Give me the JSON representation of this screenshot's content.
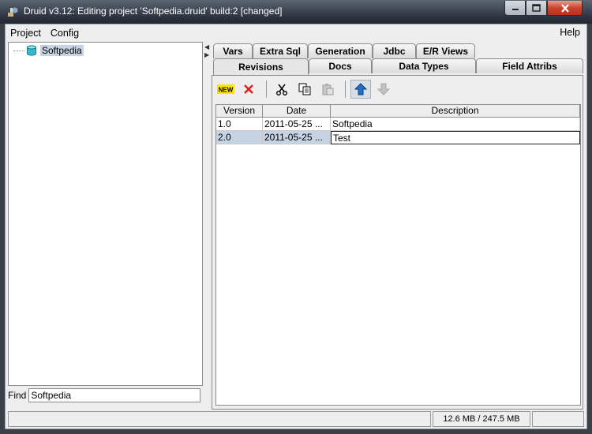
{
  "window": {
    "title": "Druid v3.12: Editing project 'Softpedia.druid' build:2 [changed]"
  },
  "menu": {
    "project": "Project",
    "config": "Config",
    "help": "Help"
  },
  "tree": {
    "root_label": "Softpedia"
  },
  "find": {
    "label": "Find",
    "value": "Softpedia"
  },
  "tabs": {
    "row1": [
      "Vars",
      "Extra Sql",
      "Generation",
      "Jdbc",
      "E/R Views"
    ],
    "row2": [
      "Revisions",
      "Docs",
      "Data Types",
      "Field Attribs"
    ],
    "active": "Revisions"
  },
  "toolbar": {
    "new_label": "NEW"
  },
  "table": {
    "columns": [
      "Version",
      "Date",
      "Description"
    ],
    "rows": [
      {
        "version": "1.0",
        "date": "2011-05-25 ...",
        "description": "Softpedia"
      },
      {
        "version": "2.0",
        "date": "2011-05-25 ...",
        "description": "Test"
      }
    ],
    "selected_row": 1
  },
  "status": {
    "memory": "12.6 MB / 247.5 MB"
  },
  "colors": {
    "selection": "#c5d3e3",
    "close_button": "#c8452f",
    "up_arrow": "#1f6fc7"
  }
}
